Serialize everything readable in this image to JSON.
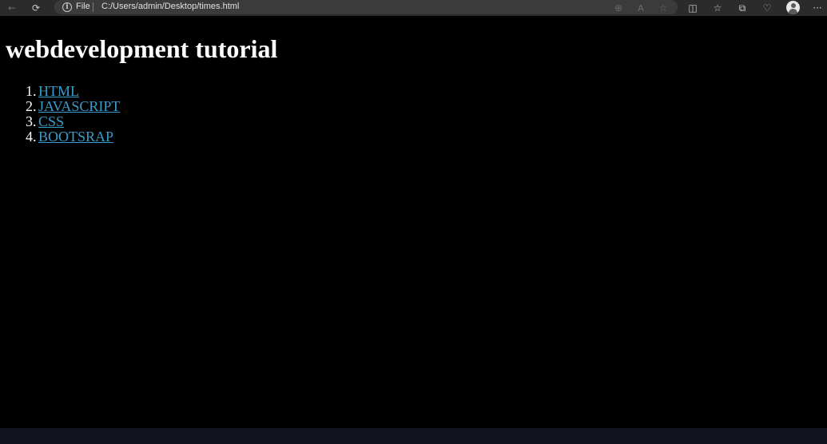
{
  "browser": {
    "address_prefix": "File",
    "url": "C:/Users/admin/Desktop/times.html",
    "info_glyph": "i",
    "icons": {
      "back": "←",
      "refresh": "⟳",
      "zoom": "⊕",
      "read_aloud": "A",
      "favorite": "☆",
      "split_screen": "◫",
      "favorites": "☆",
      "collections": "⧉",
      "extensions": "♡",
      "more": "···"
    }
  },
  "page": {
    "heading": "webdevelopment tutorial",
    "links": [
      {
        "number": "1.",
        "label": "HTML"
      },
      {
        "number": "2.",
        "label": "JAVASCRIPT"
      },
      {
        "number": "3.",
        "label": "CSS"
      },
      {
        "number": "4.",
        "label": "BOOTSRAP"
      }
    ]
  },
  "colors": {
    "page_background": "#000000",
    "link": "#3a9cc9",
    "toolbar": "#2b2b2b",
    "bottom_strip": "#10131d"
  }
}
